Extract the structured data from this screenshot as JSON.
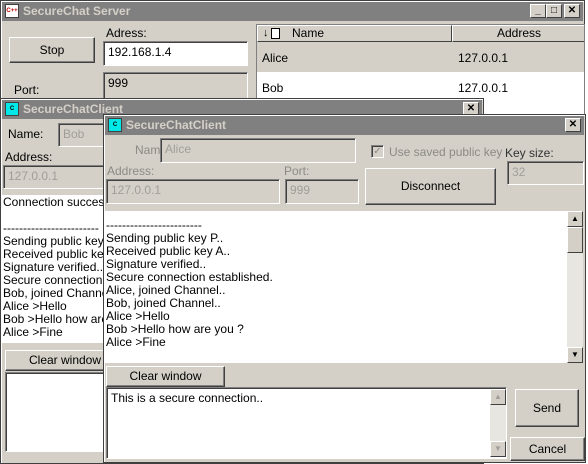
{
  "server": {
    "title": "SecureChat Server",
    "stop_label": "Stop",
    "address_label": "Adress:",
    "address_value": "192.168.1.4",
    "port_label": "Port:",
    "port_value": "999",
    "table": {
      "headers": [
        "Name",
        "Address"
      ],
      "rows": [
        {
          "name": "Alice",
          "address": "127.0.0.1"
        },
        {
          "name": "Bob",
          "address": "127.0.0.1"
        }
      ]
    }
  },
  "client_bob": {
    "title": "SecureChatClient",
    "name_label": "Name:",
    "name_value": "Bob",
    "address_label": "Address:",
    "address_value": "127.0.0.1",
    "log": [
      "Connection successful",
      "",
      "------------------------",
      "Sending public key P..",
      "Received public key A..",
      "Signature verified..",
      "Secure connection established.",
      "Bob, joined Channel..",
      "Alice >Hello",
      "Bob >Hello how are you ?",
      "Alice >Fine"
    ],
    "clear_label": "Clear window"
  },
  "client_alice": {
    "title": "SecureChatClient",
    "name_label": "Name:",
    "name_value": "Alice",
    "checkbox_label": "Use saved public key",
    "keysize_label": "Key size:",
    "keysize_value": "32",
    "address_label": "Address:",
    "address_value": "127.0.0.1",
    "port_label": "Port:",
    "port_value": "999",
    "disconnect_label": "Disconnect",
    "log": [
      "------------------------",
      "Sending public key P..",
      "Received public key A..",
      "Signature verified..",
      "Secure connection established.",
      "Alice, joined Channel..",
      "Bob, joined Channel..",
      "Alice >Hello",
      "Bob >Hello how are you ?",
      "Alice >Fine"
    ],
    "clear_label": "Clear window",
    "message_value": "This is a secure connection..",
    "send_label": "Send",
    "cancel_label": "Cancel"
  },
  "icons": {
    "minimize": "minimize-icon",
    "maximize": "maximize-icon",
    "close": "close-icon",
    "sort_down": "sort-down-icon",
    "document": "document-icon"
  }
}
